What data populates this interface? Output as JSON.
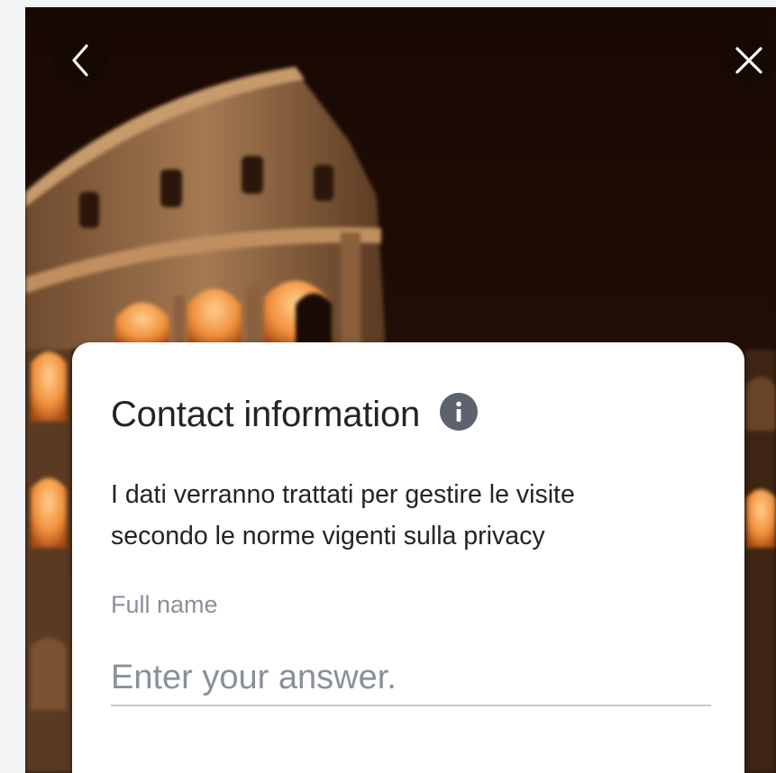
{
  "nav": {
    "back_icon": "chevron-left-icon",
    "close_icon": "close-icon"
  },
  "card": {
    "title": "Contact information",
    "info_icon": "info-icon",
    "description": "I dati verranno trattati per gestire le visite secondo le norme vigenti sulla privacy",
    "fields": [
      {
        "label": "Full name",
        "value": "",
        "placeholder": "Enter your answer."
      }
    ]
  },
  "colors": {
    "text": "#222428",
    "muted": "#8a909a",
    "info_badge": "#5d636e",
    "card_bg": "#ffffff"
  }
}
